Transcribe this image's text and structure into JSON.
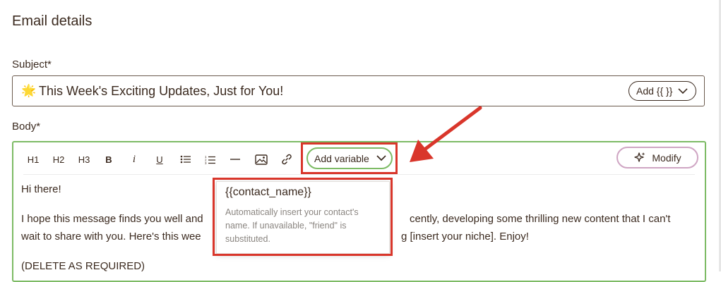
{
  "section_title": "Email details",
  "subject": {
    "label": "Subject*",
    "emoji": "🌟",
    "value": "This Week's Exciting Updates, Just for You!",
    "add_button": "Add {{ }}"
  },
  "body": {
    "label": "Body*",
    "toolbar": {
      "h1": "H1",
      "h2": "H2",
      "h3": "H3",
      "bold": "B",
      "italic": "i",
      "underline": "U",
      "add_variable": "Add variable",
      "modify": "Modify"
    },
    "lines": [
      "Hi there!",
      "I hope this message finds you well and",
      "cently, developing some thrilling new content that I can't",
      "wait to share with you. Here's this wee",
      "g [insert your niche]. Enjoy!",
      "(DELETE AS REQUIRED)"
    ]
  },
  "tooltip": {
    "title": "{{contact_name}}",
    "description": "Automatically insert your contact's name. If unavailable, \"friend\" is substituted."
  },
  "colors": {
    "annotation_red": "#d9362b",
    "focus_green": "#7dbb65",
    "text_brown": "#3b2a1f"
  }
}
